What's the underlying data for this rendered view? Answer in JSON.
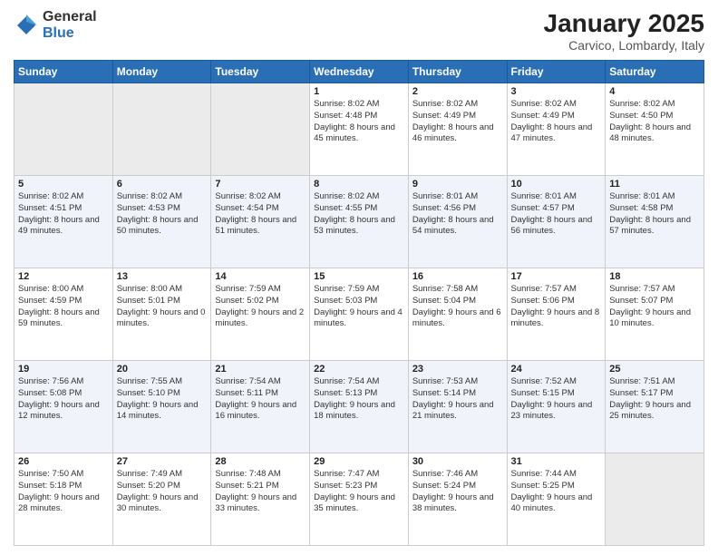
{
  "header": {
    "logo_general": "General",
    "logo_blue": "Blue",
    "title": "January 2025",
    "subtitle": "Carvico, Lombardy, Italy"
  },
  "columns": [
    "Sunday",
    "Monday",
    "Tuesday",
    "Wednesday",
    "Thursday",
    "Friday",
    "Saturday"
  ],
  "weeks": [
    [
      {
        "day": "",
        "info": ""
      },
      {
        "day": "",
        "info": ""
      },
      {
        "day": "",
        "info": ""
      },
      {
        "day": "1",
        "info": "Sunrise: 8:02 AM\nSunset: 4:48 PM\nDaylight: 8 hours\nand 45 minutes."
      },
      {
        "day": "2",
        "info": "Sunrise: 8:02 AM\nSunset: 4:49 PM\nDaylight: 8 hours\nand 46 minutes."
      },
      {
        "day": "3",
        "info": "Sunrise: 8:02 AM\nSunset: 4:49 PM\nDaylight: 8 hours\nand 47 minutes."
      },
      {
        "day": "4",
        "info": "Sunrise: 8:02 AM\nSunset: 4:50 PM\nDaylight: 8 hours\nand 48 minutes."
      }
    ],
    [
      {
        "day": "5",
        "info": "Sunrise: 8:02 AM\nSunset: 4:51 PM\nDaylight: 8 hours\nand 49 minutes."
      },
      {
        "day": "6",
        "info": "Sunrise: 8:02 AM\nSunset: 4:53 PM\nDaylight: 8 hours\nand 50 minutes."
      },
      {
        "day": "7",
        "info": "Sunrise: 8:02 AM\nSunset: 4:54 PM\nDaylight: 8 hours\nand 51 minutes."
      },
      {
        "day": "8",
        "info": "Sunrise: 8:02 AM\nSunset: 4:55 PM\nDaylight: 8 hours\nand 53 minutes."
      },
      {
        "day": "9",
        "info": "Sunrise: 8:01 AM\nSunset: 4:56 PM\nDaylight: 8 hours\nand 54 minutes."
      },
      {
        "day": "10",
        "info": "Sunrise: 8:01 AM\nSunset: 4:57 PM\nDaylight: 8 hours\nand 56 minutes."
      },
      {
        "day": "11",
        "info": "Sunrise: 8:01 AM\nSunset: 4:58 PM\nDaylight: 8 hours\nand 57 minutes."
      }
    ],
    [
      {
        "day": "12",
        "info": "Sunrise: 8:00 AM\nSunset: 4:59 PM\nDaylight: 8 hours\nand 59 minutes."
      },
      {
        "day": "13",
        "info": "Sunrise: 8:00 AM\nSunset: 5:01 PM\nDaylight: 9 hours\nand 0 minutes."
      },
      {
        "day": "14",
        "info": "Sunrise: 7:59 AM\nSunset: 5:02 PM\nDaylight: 9 hours\nand 2 minutes."
      },
      {
        "day": "15",
        "info": "Sunrise: 7:59 AM\nSunset: 5:03 PM\nDaylight: 9 hours\nand 4 minutes."
      },
      {
        "day": "16",
        "info": "Sunrise: 7:58 AM\nSunset: 5:04 PM\nDaylight: 9 hours\nand 6 minutes."
      },
      {
        "day": "17",
        "info": "Sunrise: 7:57 AM\nSunset: 5:06 PM\nDaylight: 9 hours\nand 8 minutes."
      },
      {
        "day": "18",
        "info": "Sunrise: 7:57 AM\nSunset: 5:07 PM\nDaylight: 9 hours\nand 10 minutes."
      }
    ],
    [
      {
        "day": "19",
        "info": "Sunrise: 7:56 AM\nSunset: 5:08 PM\nDaylight: 9 hours\nand 12 minutes."
      },
      {
        "day": "20",
        "info": "Sunrise: 7:55 AM\nSunset: 5:10 PM\nDaylight: 9 hours\nand 14 minutes."
      },
      {
        "day": "21",
        "info": "Sunrise: 7:54 AM\nSunset: 5:11 PM\nDaylight: 9 hours\nand 16 minutes."
      },
      {
        "day": "22",
        "info": "Sunrise: 7:54 AM\nSunset: 5:13 PM\nDaylight: 9 hours\nand 18 minutes."
      },
      {
        "day": "23",
        "info": "Sunrise: 7:53 AM\nSunset: 5:14 PM\nDaylight: 9 hours\nand 21 minutes."
      },
      {
        "day": "24",
        "info": "Sunrise: 7:52 AM\nSunset: 5:15 PM\nDaylight: 9 hours\nand 23 minutes."
      },
      {
        "day": "25",
        "info": "Sunrise: 7:51 AM\nSunset: 5:17 PM\nDaylight: 9 hours\nand 25 minutes."
      }
    ],
    [
      {
        "day": "26",
        "info": "Sunrise: 7:50 AM\nSunset: 5:18 PM\nDaylight: 9 hours\nand 28 minutes."
      },
      {
        "day": "27",
        "info": "Sunrise: 7:49 AM\nSunset: 5:20 PM\nDaylight: 9 hours\nand 30 minutes."
      },
      {
        "day": "28",
        "info": "Sunrise: 7:48 AM\nSunset: 5:21 PM\nDaylight: 9 hours\nand 33 minutes."
      },
      {
        "day": "29",
        "info": "Sunrise: 7:47 AM\nSunset: 5:23 PM\nDaylight: 9 hours\nand 35 minutes."
      },
      {
        "day": "30",
        "info": "Sunrise: 7:46 AM\nSunset: 5:24 PM\nDaylight: 9 hours\nand 38 minutes."
      },
      {
        "day": "31",
        "info": "Sunrise: 7:44 AM\nSunset: 5:25 PM\nDaylight: 9 hours\nand 40 minutes."
      },
      {
        "day": "",
        "info": ""
      }
    ]
  ]
}
